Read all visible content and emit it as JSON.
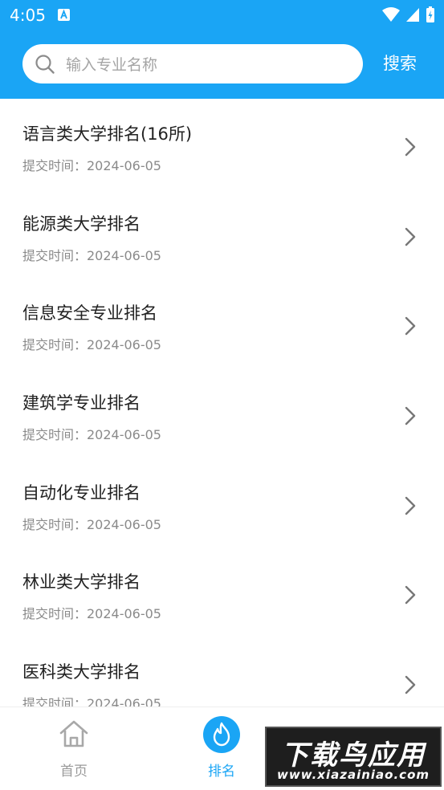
{
  "status_bar": {
    "time": "4:05"
  },
  "search": {
    "placeholder": "输入专业名称",
    "value": "",
    "button_label": "搜索"
  },
  "list": {
    "items": [
      {
        "title": "语言类大学排名(16所)",
        "subtitle": "提交时间：2024-06-05"
      },
      {
        "title": "能源类大学排名",
        "subtitle": "提交时间：2024-06-05"
      },
      {
        "title": "信息安全专业排名",
        "subtitle": "提交时间：2024-06-05"
      },
      {
        "title": "建筑学专业排名",
        "subtitle": "提交时间：2024-06-05"
      },
      {
        "title": "自动化专业排名",
        "subtitle": "提交时间：2024-06-05"
      },
      {
        "title": "林业类大学排名",
        "subtitle": "提交时间：2024-06-05"
      },
      {
        "title": "医科类大学排名",
        "subtitle": "提交时间：2024-06-05"
      }
    ]
  },
  "bottom_nav": {
    "home_label": "首页",
    "ranking_label": "排名"
  },
  "watermark": {
    "big_text": "下载鸟应用",
    "url_text": "www.xiazainiao.com"
  },
  "icons": {
    "search": "search-icon",
    "chevron": "chevron-right-icon",
    "home": "home-icon",
    "ranking": "flame-icon"
  },
  "colors": {
    "accent": "#1aa5f5",
    "title_text": "#222222",
    "subtitle_text": "#8a8a8a",
    "inactive_nav": "#9a9a9a"
  }
}
